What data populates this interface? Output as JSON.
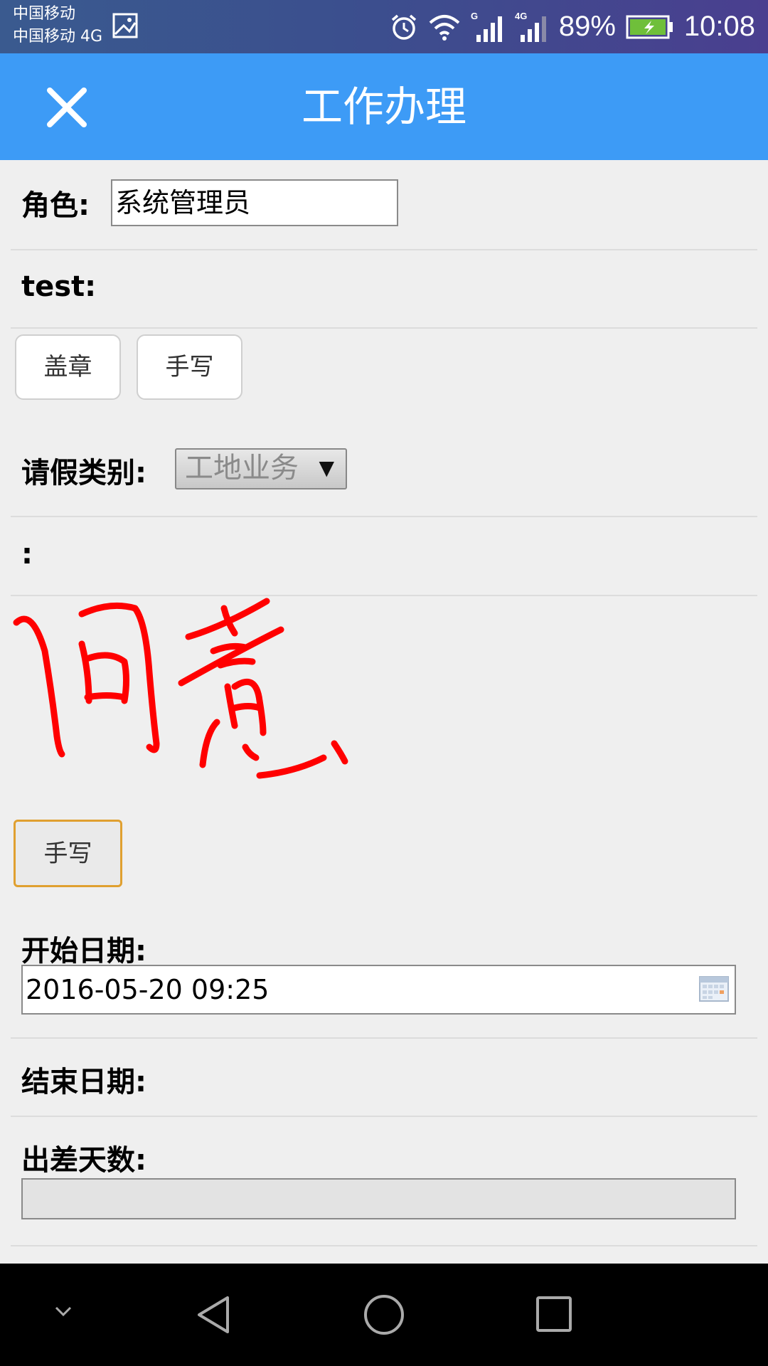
{
  "status_bar": {
    "carrier_1": "中国移动",
    "carrier_2": "中国移动 4G",
    "sim1_network": "G",
    "sim2_network": "4G",
    "battery": "89%",
    "time": "10:08"
  },
  "header": {
    "title": "工作办理"
  },
  "form": {
    "role_label": "角色:",
    "role_value": "系统管理员",
    "test_label": "test:",
    "stamp_button": "盖章",
    "handwrite_button_1": "手写",
    "leave_type_label": "请假类别:",
    "leave_type_value": "工地业务",
    "blank_label": ":",
    "handwrite_button_2": "手写",
    "start_date_label": "开始日期:",
    "start_date_value": "2016-05-20 09:25",
    "end_date_label": "结束日期:",
    "trip_days_label": "出差天数:",
    "trip_days_value": ""
  },
  "signature": {
    "handwritten_text": "同意",
    "ink_color": "#ff0000"
  },
  "colors": {
    "header_bg": "#3d9bf6",
    "status_bar_bg": "#3b4f8e",
    "page_bg": "#efefef",
    "focus_border": "#e0a030"
  }
}
